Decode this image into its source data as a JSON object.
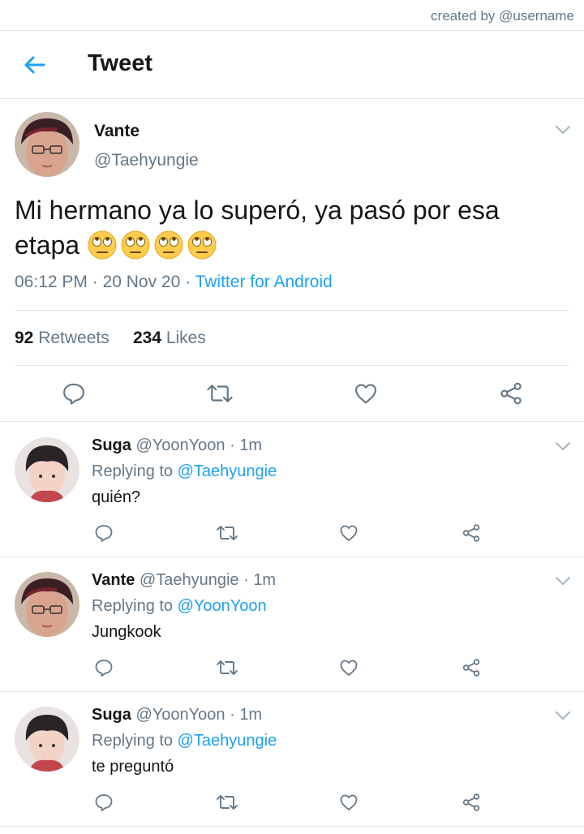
{
  "credit": "created by @username",
  "header": {
    "title": "Tweet",
    "back_icon": "arrow-left-icon",
    "accent": "#1da1f2"
  },
  "main_tweet": {
    "name": "Vante",
    "handle": "@Taehyungie",
    "text": "Mi hermano ya lo superó, ya pasó por esa etapa",
    "emoji": [
      "face-with-rolling-eyes",
      "face-with-rolling-eyes",
      "face-with-rolling-eyes",
      "face-with-rolling-eyes"
    ],
    "time": "06:12 PM",
    "date": "20 Nov 20",
    "source": "Twitter for Android",
    "retweets_count": "92",
    "retweets_label": "Retweets",
    "likes_count": "234",
    "likes_label": "Likes"
  },
  "replies": [
    {
      "name": "Suga",
      "handle": "@YoonYoon",
      "time": "1m",
      "replying_prefix": "Replying to",
      "replying_to": "@Taehyungie",
      "text": "quién?"
    },
    {
      "name": "Vante",
      "handle": "@Taehyungie",
      "time": "1m",
      "replying_prefix": "Replying to",
      "replying_to": "@YoonYoon",
      "text": "Jungkook"
    },
    {
      "name": "Suga",
      "handle": "@YoonYoon",
      "time": "1m",
      "replying_prefix": "Replying to",
      "replying_to": "@Taehyungie",
      "text": "te preguntó"
    }
  ],
  "icons": {
    "reply": "reply-icon",
    "retweet": "retweet-icon",
    "like": "like-icon",
    "share": "share-icon",
    "more": "chevron-down-icon"
  }
}
